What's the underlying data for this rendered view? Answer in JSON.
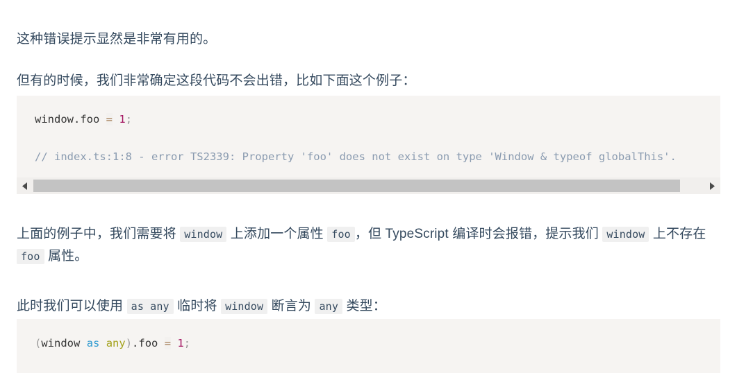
{
  "document": {
    "paragraph_1": "这种错误提示显然是非常有用的。",
    "paragraph_2": "但有的时候，我们非常确定这段代码不会出错，比如下面这个例子：",
    "paragraph_3": {
      "text_a": "上面的例子中，我们需要将",
      "code_a": "window",
      "text_b": "上添加一个属性",
      "code_b": "foo",
      "text_c": "，但 TypeScript 编译时会报错，提示我们",
      "code_c": "window",
      "text_d": "上不存在",
      "code_d": "foo",
      "text_e": "属性。"
    },
    "paragraph_4": {
      "text_a": "此时我们可以使用",
      "code_a": "as any",
      "text_b": "临时将",
      "code_b": "window",
      "text_c": "断言为",
      "code_c": "any",
      "text_d": "类型："
    }
  },
  "code_block_1": {
    "line_1": {
      "identifier": "window.foo",
      "space_1": " ",
      "operator": "=",
      "space_2": " ",
      "number": "1",
      "semicolon": ";"
    },
    "line_2_blank": "",
    "line_3_comment": "// index.ts:1:8 - error TS2339: Property 'foo' does not exist on type 'Window & typeof globalThis'."
  },
  "code_block_2": {
    "line_1": {
      "paren_open": "(",
      "identifier_1": "window",
      "space_1": " ",
      "keyword": "as",
      "space_2": " ",
      "type": "any",
      "paren_close": ")",
      "member": ".foo",
      "space_3": " ",
      "operator": "=",
      "space_4": " ",
      "number": "1",
      "semicolon": ";"
    }
  },
  "scrollbar": {
    "left_arrow_icon": "triangle-left-icon",
    "right_arrow_icon": "triangle-right-icon",
    "thumb_left_pct": 0,
    "thumb_width_pct": 96.5
  },
  "colors": {
    "page_background": "#ffffff",
    "body_text": "#34495e",
    "code_block_background": "#f6f4f2",
    "inline_code_background": "#f0f0f0",
    "scrollbar_track": "#f1efed",
    "scrollbar_thumb": "#c3c3c3",
    "token_comment": "#8a9bb0",
    "token_number": "#a31561",
    "token_keyword": "#2f9ad0",
    "token_type": "#a3a11b",
    "token_punct": "#999999"
  }
}
